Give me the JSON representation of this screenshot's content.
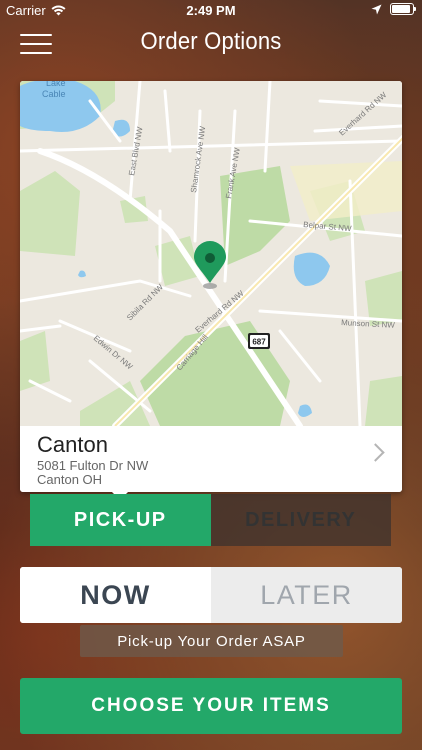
{
  "status_bar": {
    "carrier": "Carrier",
    "time": "2:49 PM"
  },
  "header": {
    "title": "Order Options"
  },
  "map": {
    "labels": {
      "lake": "Lake Cable",
      "east_blvd": "East Blvd NW",
      "shamrock": "Shamrock Ave NW",
      "frank": "Frank Ave NW",
      "everhard_top": "Everhard Rd NW",
      "belpar": "Belpar St NW",
      "sibila": "Sibila Rd NW",
      "everhard_mid": "Everhard Rd NW",
      "munson": "Munson St NW",
      "edwin": "Edwin Dr NW",
      "carriage": "Carriage Hill",
      "shield": "687"
    }
  },
  "location": {
    "name": "Canton",
    "address_line1": "5081 Fulton Dr NW",
    "address_line2": "Canton OH"
  },
  "order_type": {
    "pickup_label": "PICK-UP",
    "delivery_label": "DELIVERY"
  },
  "timing": {
    "now_label": "NOW",
    "later_label": "LATER",
    "note": "Pick-up Your Order ASAP"
  },
  "cta": {
    "label": "CHOOSE YOUR ITEMS"
  },
  "colors": {
    "accent_green": "#23a869",
    "map_pin": "#1f9a5c"
  }
}
